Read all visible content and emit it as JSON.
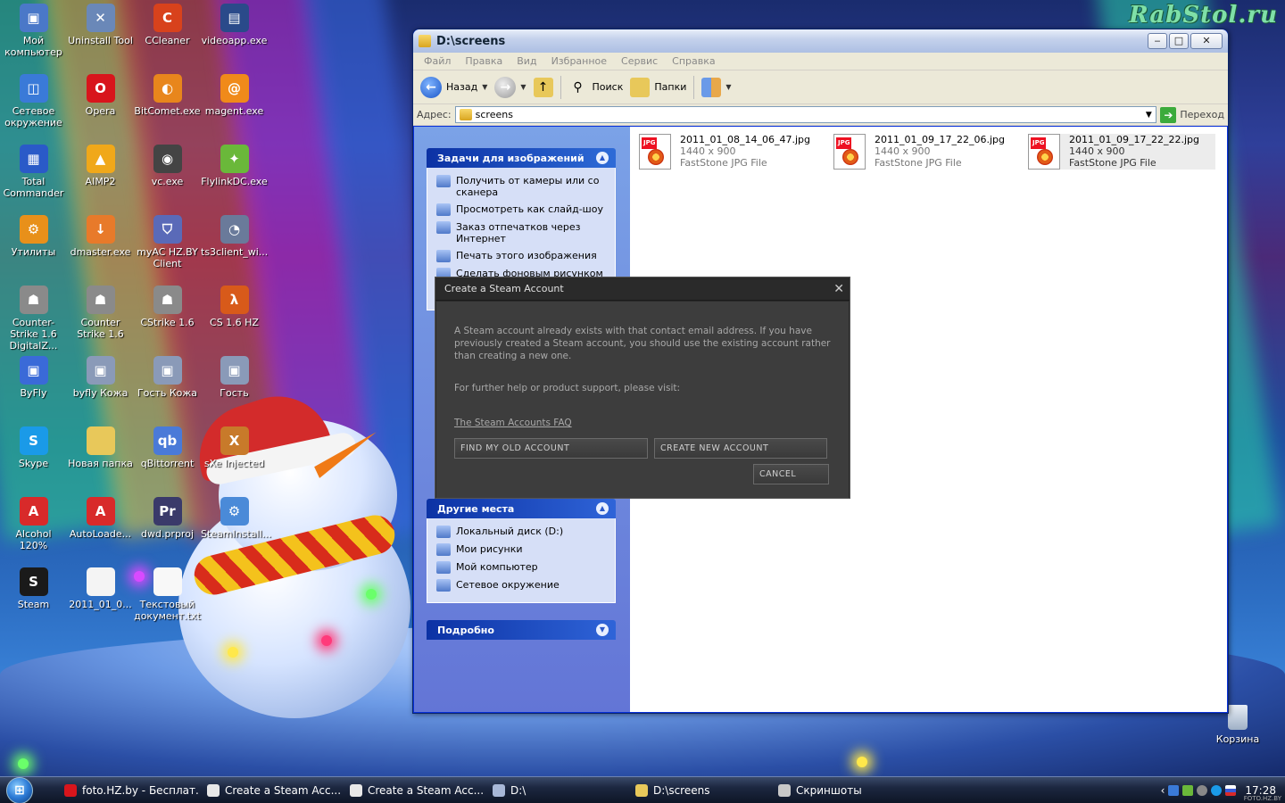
{
  "watermark": "RabStol.ru",
  "desktop_icons": [
    {
      "label": "Мой компьютер",
      "icon": "my-computer-icon",
      "color": "#4a78c8",
      "glyph": "▣"
    },
    {
      "label": "Uninstall Tool",
      "icon": "uninstall-tool-icon",
      "color": "#6a88b8",
      "glyph": "✕"
    },
    {
      "label": "CCleaner",
      "icon": "ccleaner-icon",
      "color": "#d8421c",
      "glyph": "C"
    },
    {
      "label": "videoapp.exe",
      "icon": "videoapp-icon",
      "color": "#2a4a8a",
      "glyph": "▤"
    },
    {
      "label": "Сетевое окружение",
      "icon": "network-icon",
      "color": "#3a7ad8",
      "glyph": "◫"
    },
    {
      "label": "Opera",
      "icon": "opera-icon",
      "color": "#d8151c",
      "glyph": "O"
    },
    {
      "label": "BitComet.exe",
      "icon": "bitcomet-icon",
      "color": "#e8861c",
      "glyph": "◐"
    },
    {
      "label": "magent.exe",
      "icon": "magent-icon",
      "color": "#f08a1a",
      "glyph": "@"
    },
    {
      "label": "Total Commander",
      "icon": "total-commander-icon",
      "color": "#2a5ac8",
      "glyph": "▦"
    },
    {
      "label": "AIMP2",
      "icon": "aimp-icon",
      "color": "#f0a81a",
      "glyph": "▲"
    },
    {
      "label": "vc.exe",
      "icon": "vc-icon",
      "color": "#444444",
      "glyph": "◉"
    },
    {
      "label": "FlylinkDC.exe",
      "icon": "flylinkdc-icon",
      "color": "#6ab83a",
      "glyph": "✦"
    },
    {
      "label": "Утилиты",
      "icon": "utilities-icon",
      "color": "#e8901a",
      "glyph": "⚙"
    },
    {
      "label": "dmaster.exe",
      "icon": "dmaster-icon",
      "color": "#e87a2a",
      "glyph": "↓"
    },
    {
      "label": "myAC HZ.BY Client",
      "icon": "myac-icon",
      "color": "#5a6ab8",
      "glyph": "⛉"
    },
    {
      "label": "ts3client_wi...",
      "icon": "teamspeak-icon",
      "color": "#6a7a9a",
      "glyph": "◔"
    },
    {
      "label": "Counter-Strike 1.6 DigitalZ...",
      "icon": "counter-strike-icon",
      "color": "#8a8a8a",
      "glyph": "☗"
    },
    {
      "label": "Counter Strike 1.6",
      "icon": "counter-strike-icon",
      "color": "#8a8a8a",
      "glyph": "☗"
    },
    {
      "label": "CStrike 1.6",
      "icon": "counter-strike-icon",
      "color": "#8a8a8a",
      "glyph": "☗"
    },
    {
      "label": "CS 1.6 HZ",
      "icon": "half-life-icon",
      "color": "#d85a1a",
      "glyph": "λ"
    },
    {
      "label": "ByFly",
      "icon": "byfly-icon",
      "color": "#3a6ad8",
      "glyph": "▣"
    },
    {
      "label": "byfly Кожа",
      "icon": "byfly-icon",
      "color": "#8a9ab8",
      "glyph": "▣"
    },
    {
      "label": "Гость Кожа",
      "icon": "guest-icon",
      "color": "#8a9ab8",
      "glyph": "▣"
    },
    {
      "label": "Гость",
      "icon": "guest-icon",
      "color": "#8a9ab8",
      "glyph": "▣"
    },
    {
      "label": "Skype",
      "icon": "skype-icon",
      "color": "#1a9ae8",
      "glyph": "S"
    },
    {
      "label": "Новая папка",
      "icon": "folder-icon",
      "color": "#e8c85a",
      "glyph": ""
    },
    {
      "label": "qBittorrent",
      "icon": "qbittorrent-icon",
      "color": "#4a7ad8",
      "glyph": "qb"
    },
    {
      "label": "sXe Injected",
      "icon": "sxe-icon",
      "color": "#c87a2a",
      "glyph": "X"
    },
    {
      "label": "Alcohol 120%",
      "icon": "alcohol-icon",
      "color": "#d82a2a",
      "glyph": "A"
    },
    {
      "label": "AutoLoade...",
      "icon": "alcohol-icon",
      "color": "#d82a2a",
      "glyph": "A"
    },
    {
      "label": "dwd.prproj",
      "icon": "premiere-icon",
      "color": "#3a3a6a",
      "glyph": "Pr"
    },
    {
      "label": "SteamInstall...",
      "icon": "steam-install-icon",
      "color": "#4a8ad8",
      "glyph": "⚙"
    },
    {
      "label": "Steam",
      "icon": "steam-icon",
      "color": "#1a1a1a",
      "glyph": "S"
    },
    {
      "label": "2011_01_0...",
      "icon": "jpg-file-icon",
      "color": "#f4f4f4",
      "glyph": ""
    },
    {
      "label": "Текстовый документ.txt",
      "icon": "text-file-icon",
      "color": "#f8f8f8",
      "glyph": ""
    }
  ],
  "recycle_bin": {
    "label": "Корзина"
  },
  "explorer": {
    "title": "D:\\screens",
    "menu": [
      "Файл",
      "Правка",
      "Вид",
      "Избранное",
      "Сервис",
      "Справка"
    ],
    "toolbar": {
      "back": "Назад",
      "search": "Поиск",
      "folders": "Папки"
    },
    "address_label": "Адрес:",
    "address_value": "screens",
    "go_label": "Переход",
    "image_tasks": {
      "title": "Задачи для изображений",
      "items": [
        "Получить от камеры или со сканера",
        "Просмотреть как слайд-шоу",
        "Заказ отпечатков через Интернет",
        "Печать этого изображения",
        "Сделать фоновым рисунком"
      ]
    },
    "other_places": {
      "title": "Другие места",
      "items": [
        "Локальный диск (D:)",
        "Мои рисунки",
        "Мой компьютер",
        "Сетевое окружение"
      ]
    },
    "details": {
      "title": "Подробно"
    },
    "files": [
      {
        "name": "2011_01_08_14_06_47.jpg",
        "dims": "1440 x 900",
        "type": "FastStone JPG File",
        "tag": "JPG"
      },
      {
        "name": "2011_01_09_17_22_06.jpg",
        "dims": "1440 x 900",
        "type": "FastStone JPG File",
        "tag": "JPG"
      },
      {
        "name": "2011_01_09_17_22_22.jpg",
        "dims": "1440 x 900",
        "type": "FastStone JPG File",
        "tag": "JPG"
      }
    ]
  },
  "steam_dialog": {
    "title": "Create a Steam Account",
    "message": "A Steam account already exists with that contact email address. If you have previously created a Steam account, you should use the existing account rather than creating a new one.",
    "help": "For further help or product support, please visit:",
    "link": "The Steam Accounts FAQ",
    "find_button": "FIND MY OLD ACCOUNT",
    "create_button": "CREATE NEW ACCOUNT",
    "cancel_button": "CANCEL"
  },
  "taskbar": {
    "tasks": [
      {
        "label": "foto.HZ.by - Бесплат...",
        "color": "#d8151c"
      },
      {
        "label": "Create a Steam Acc...",
        "color": "#e8e8e8"
      },
      {
        "label": "Create a Steam Acc...",
        "color": "#e8e8e8"
      },
      {
        "label": "D:\\",
        "color": "#a8b8d8"
      },
      {
        "label": "D:\\screens",
        "color": "#e8c85a"
      },
      {
        "label": "Скриншоты",
        "color": "#c8c8c8"
      }
    ],
    "clock": "17:28",
    "brand": "FOTO.HZ.BY"
  }
}
